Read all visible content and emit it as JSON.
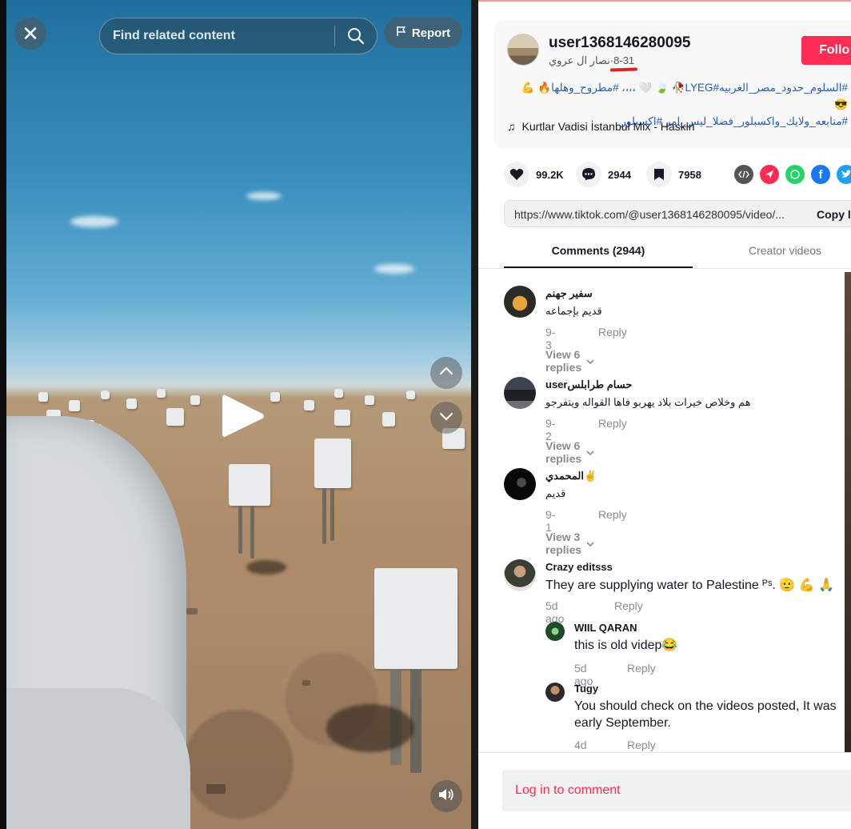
{
  "video": {
    "close_icon": "close-icon",
    "search_placeholder": "Find related content",
    "report_label": "Report",
    "play_icon": "play-icon",
    "volume_icon": "volume-icon"
  },
  "author": {
    "username": "user1368146280095",
    "display_name": "نصار ال عروي",
    "separator": " · ",
    "date": "8-31",
    "follow_label": "Follo"
  },
  "description": {
    "line1": "#السلوم_حدود_مصر_الغربيه#LYEG🥀 🍃 🤍 ،،،، #مطروح_وهلها🔥 💪 😎",
    "line2": "#متابعه_ولايك_واكسبلور_فضلا_ليس_امر #اكسبلور",
    "music": "Kurtlar Vadisi İstanbul Mix - Haskin"
  },
  "actions": {
    "likes": "99.2K",
    "comments": "2944",
    "saves": "7958"
  },
  "share": {
    "url": "https://www.tiktok.com/@user1368146280095/video/...",
    "copy_label": "Copy l"
  },
  "tabs": {
    "comments_label": "Comments (2944)",
    "creator_label": "Creator videos"
  },
  "comments": [
    {
      "name": "سفير جهنم",
      "text": "قديم بإجماعه",
      "date": "9-3",
      "reply": "Reply",
      "view_replies": "View 6 replies"
    },
    {
      "name": "userحسام طرابلس",
      "text": "هم وخلاص خيرات بلاد يهربو فاها القواله ويتفرجو",
      "date": "9-2",
      "reply": "Reply",
      "view_replies": "View 6 replies"
    },
    {
      "name": "المحمدي✌️",
      "text": "قديم",
      "date": "9-1",
      "reply": "Reply",
      "view_replies": "View 3 replies"
    },
    {
      "name": "Crazy editsss",
      "text": "They are supplying water to Palestine ᴾˢ. 🫡 💪 🙏",
      "date": "5d ago",
      "reply": "Reply"
    }
  ],
  "replies": [
    {
      "name": "WIIL QARAN",
      "text": "this is old videp😂",
      "date": "5d ago",
      "reply": "Reply"
    },
    {
      "name": "Tugy",
      "text": "You should check on the videos posted, It was early September.",
      "date": "4d ago",
      "reply": "Reply"
    }
  ],
  "login": {
    "label": "Log in to comment"
  },
  "colors": {
    "brand": "#fe2c55",
    "hashtag": "#2b5db2"
  }
}
